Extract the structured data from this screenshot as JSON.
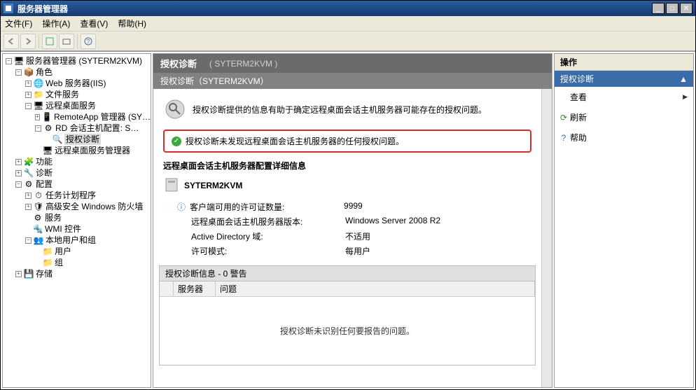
{
  "window": {
    "title": "服务器管理器"
  },
  "menu": {
    "file": "文件(F)",
    "action": "操作(A)",
    "view": "查看(V)",
    "help": "帮助(H)"
  },
  "tree": {
    "root": "服务器管理器 (SYTERM2KVM)",
    "roles": "角色",
    "web": "Web 服务器(IIS)",
    "fileservice": "文件服务",
    "rds": "远程桌面服务",
    "remoteapp": "RemoteApp 管理器 (SY…",
    "rdconfig": "RD 会话主机配置: S…",
    "authdiag": "授权诊断",
    "rds_server_mgr": "远程桌面服务管理器",
    "features": "功能",
    "diagnostics": "诊断",
    "config": "配置",
    "tasksched": "任务计划程序",
    "firewall": "高级安全 Windows 防火墙",
    "services": "服务",
    "wmi": "WMI 控件",
    "localusers": "本地用户和组",
    "users": "用户",
    "groups": "组",
    "storage": "存储"
  },
  "header": {
    "title": "授权诊断",
    "server": "( SYTERM2KVM )",
    "subtitle": "授权诊断（SYTERM2KVM）"
  },
  "intro_text": "授权诊断提供的信息有助于确定远程桌面会话主机服务器可能存在的授权问题。",
  "status_text": "授权诊断未发现远程桌面会话主机服务器的任何授权问题。",
  "details_heading": "远程桌面会话主机服务器配置详细信息",
  "server_name": "SYTERM2KVM",
  "detail_rows": {
    "licenses": {
      "k": "客户端可用的许可证数量:",
      "v": "9999"
    },
    "version": {
      "k": "远程桌面会话主机服务器版本:",
      "v": "Windows Server 2008 R2"
    },
    "ad": {
      "k": "Active Directory 域:",
      "v": "不适用"
    },
    "mode": {
      "k": "许可模式:",
      "v": "每用户"
    }
  },
  "diag_panel_header": "授权诊断信息 - 0 警告",
  "table": {
    "col_server": "服务器",
    "col_issue": "问题"
  },
  "empty_message": "授权诊断未识别任何要报告的问题。",
  "actions": {
    "title": "操作",
    "subtitle": "授权诊断",
    "view": "查看",
    "refresh": "刷新",
    "help": "帮助"
  }
}
